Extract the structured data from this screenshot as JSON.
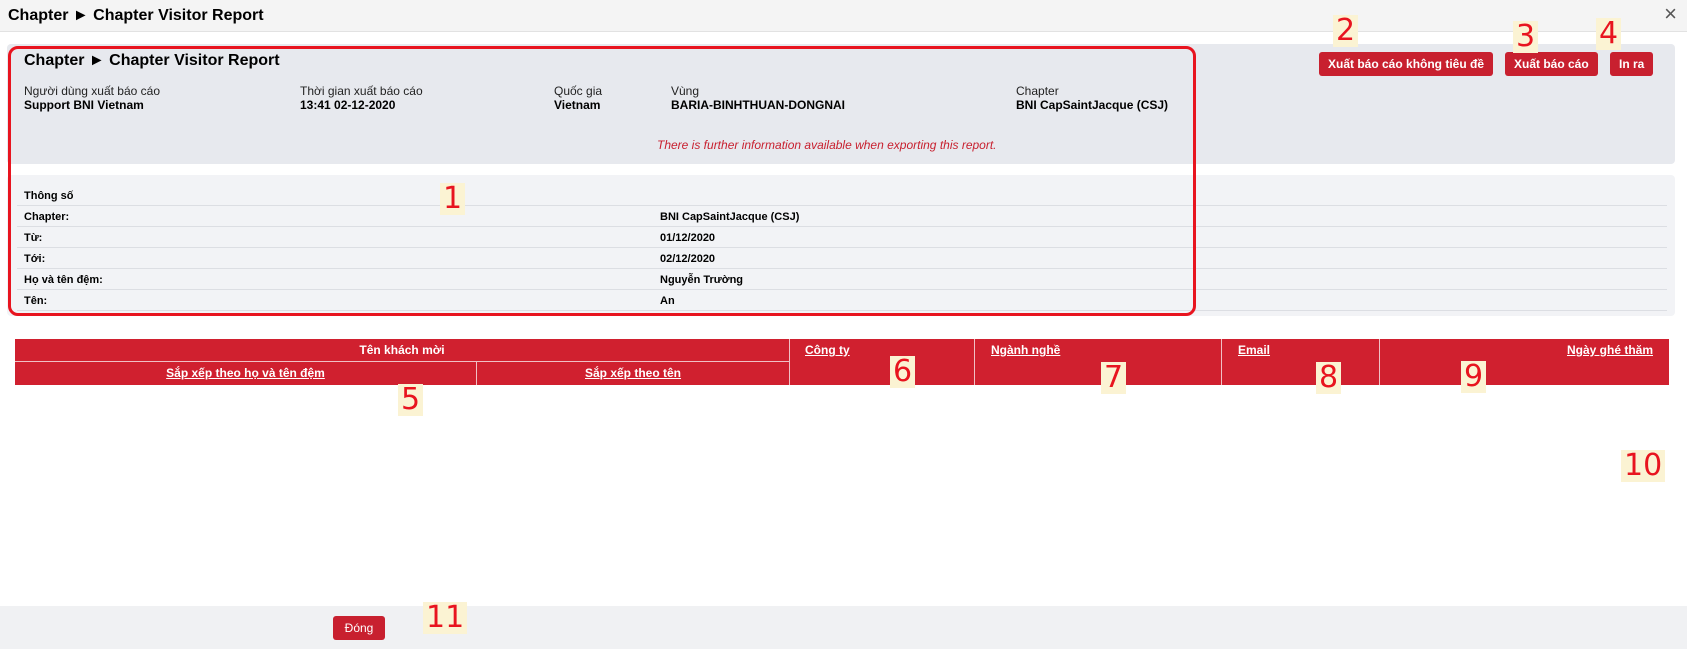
{
  "window": {
    "title": "Chapter ► Chapter Visitor Report",
    "close_icon": "×"
  },
  "report": {
    "title": "Chapter ► Chapter Visitor Report",
    "meta": [
      {
        "label": "Người dùng xuất báo cáo",
        "value": "Support BNI Vietnam"
      },
      {
        "label": "Thời gian xuất báo cáo",
        "value": "13:41 02-12-2020"
      },
      {
        "label": "Quốc gia",
        "value": "Vietnam"
      },
      {
        "label": "Vùng",
        "value": "BARIA-BINHTHUAN-DONGNAI"
      },
      {
        "label": "Chapter",
        "value": "BNI CapSaintJacque (CSJ)"
      }
    ],
    "further_info": "There is further information available when exporting this report."
  },
  "toolbar": {
    "export_untitled": "Xuất báo cáo không tiêu đề",
    "export": "Xuất báo cáo",
    "print": "In ra"
  },
  "params": {
    "header": "Thông số",
    "rows": [
      {
        "label": "Chapter:",
        "value": "BNI CapSaintJacque (CSJ)"
      },
      {
        "label": "Từ:",
        "value": "01/12/2020"
      },
      {
        "label": "Tới:",
        "value": "02/12/2020"
      },
      {
        "label": "Họ và tên đệm:",
        "value": "Nguyễn Trường"
      },
      {
        "label": "Tên:",
        "value": "An"
      }
    ]
  },
  "table": {
    "guest_name": "Tên khách mời",
    "sort_by_middle_name": "Sắp xếp theo họ và tên đệm",
    "sort_by_name": "Sắp xếp theo tên",
    "company": "Công ty",
    "profession": "Ngành nghề",
    "email": "Email",
    "visit_date": "Ngày ghé thăm"
  },
  "footer": {
    "close": "Đóng"
  },
  "annotations": [
    "1",
    "2",
    "3",
    "4",
    "5",
    "6",
    "7",
    "8",
    "9",
    "10",
    "11"
  ],
  "colors": {
    "accent_red": "#c8202f",
    "header_red": "#d0202f",
    "highlight_red": "#e8141f"
  }
}
